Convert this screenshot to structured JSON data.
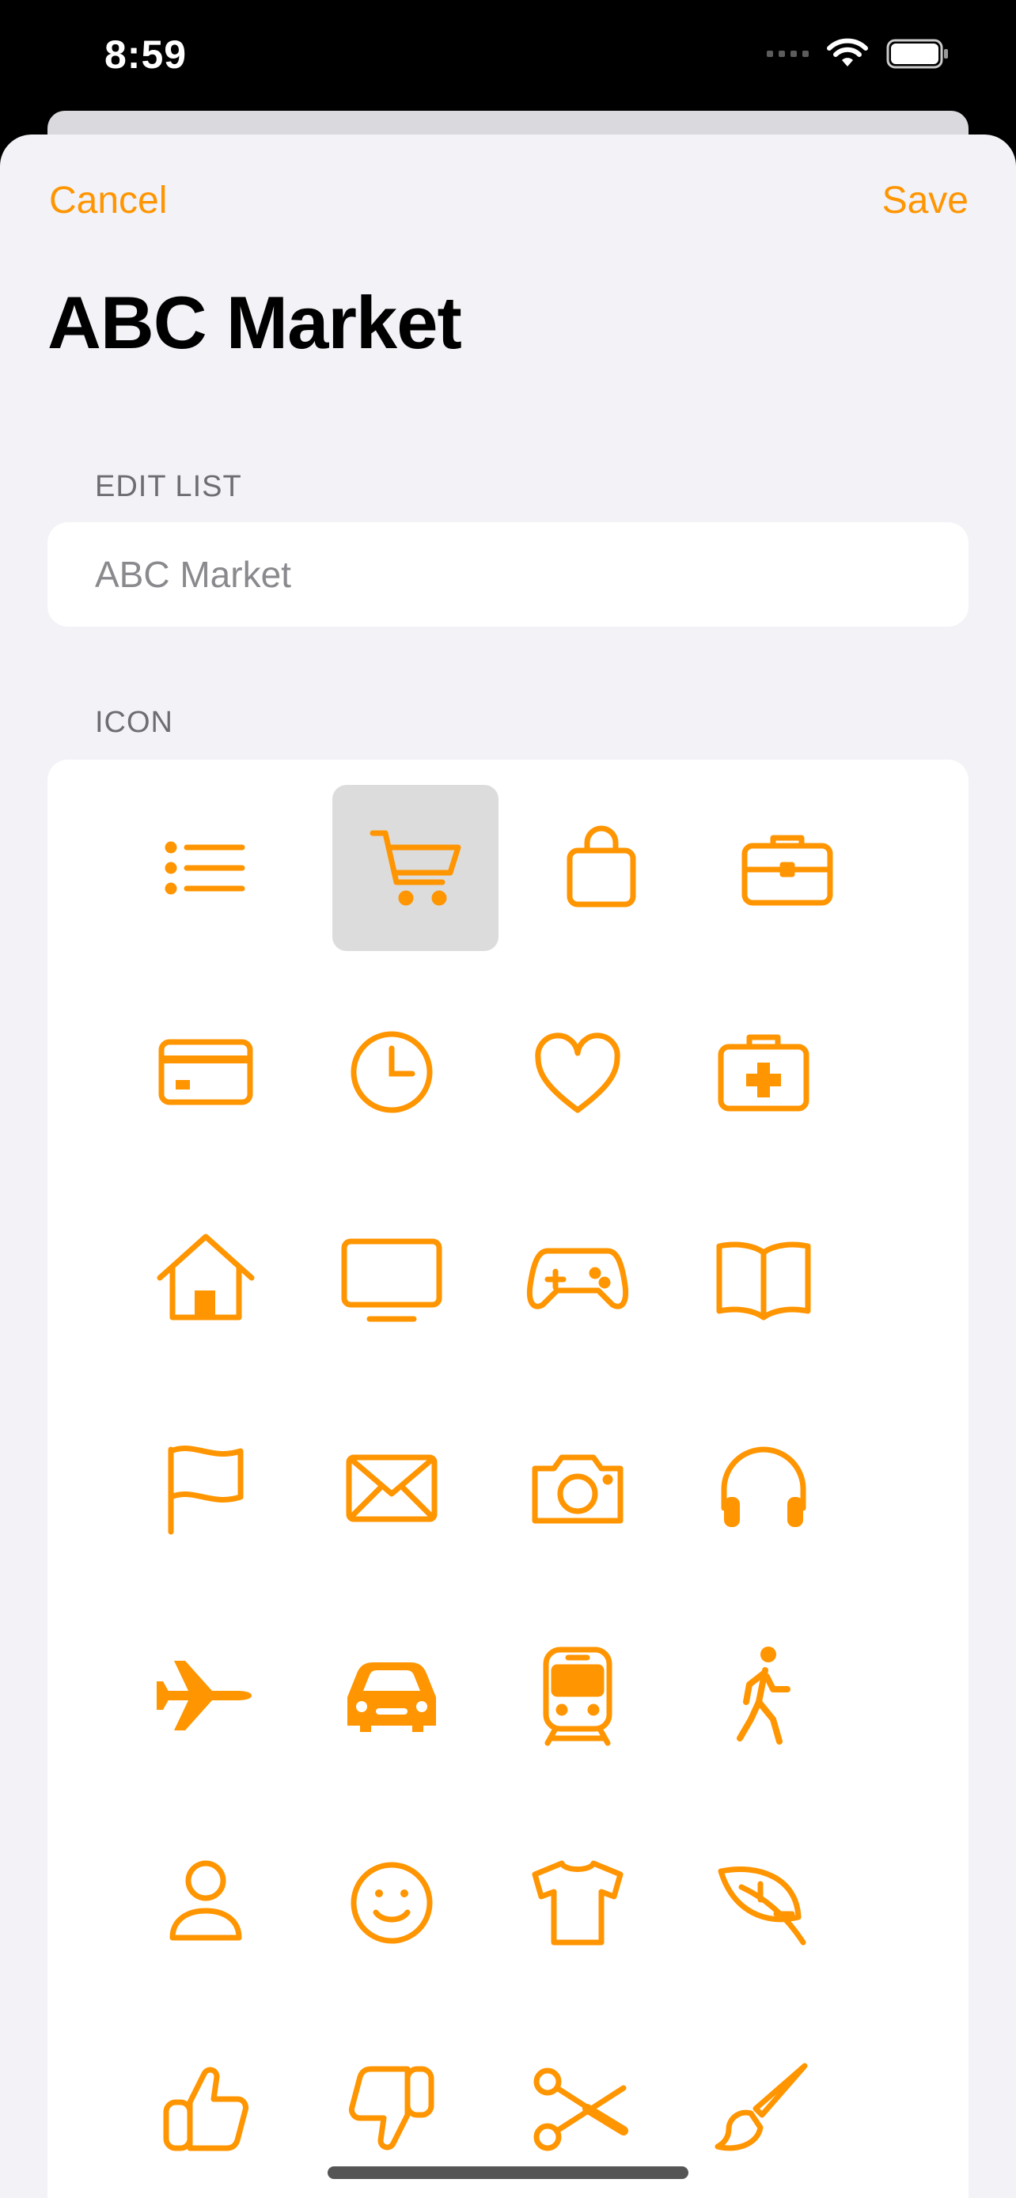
{
  "status_bar": {
    "time": "8:59"
  },
  "nav": {
    "cancel_label": "Cancel",
    "save_label": "Save"
  },
  "title": "ABC Market",
  "edit_section": {
    "header": "EDIT LIST",
    "field_value": "ABC Market"
  },
  "icon_section": {
    "header": "ICON",
    "selected": "cart-icon",
    "icons": [
      "list-icon",
      "cart-icon",
      "bag-icon",
      "briefcase-icon",
      "credit-card-icon",
      "clock-icon",
      "heart-icon",
      "medical-kit-icon",
      "house-icon",
      "tv-icon",
      "gamecontroller-icon",
      "book-icon",
      "flag-icon",
      "envelope-icon",
      "camera-icon",
      "headphones-icon",
      "airplane-icon",
      "car-icon",
      "tram-icon",
      "walking-icon",
      "person-icon",
      "smiley-icon",
      "tshirt-icon",
      "leaf-icon",
      "thumbs-up-icon",
      "thumbs-down-icon",
      "scissors-icon",
      "paintbrush-icon"
    ]
  },
  "colors": {
    "accent": "#ff9500",
    "background": "#f2f2f7",
    "card": "#ffffff",
    "selection": "#dcdcdc"
  }
}
